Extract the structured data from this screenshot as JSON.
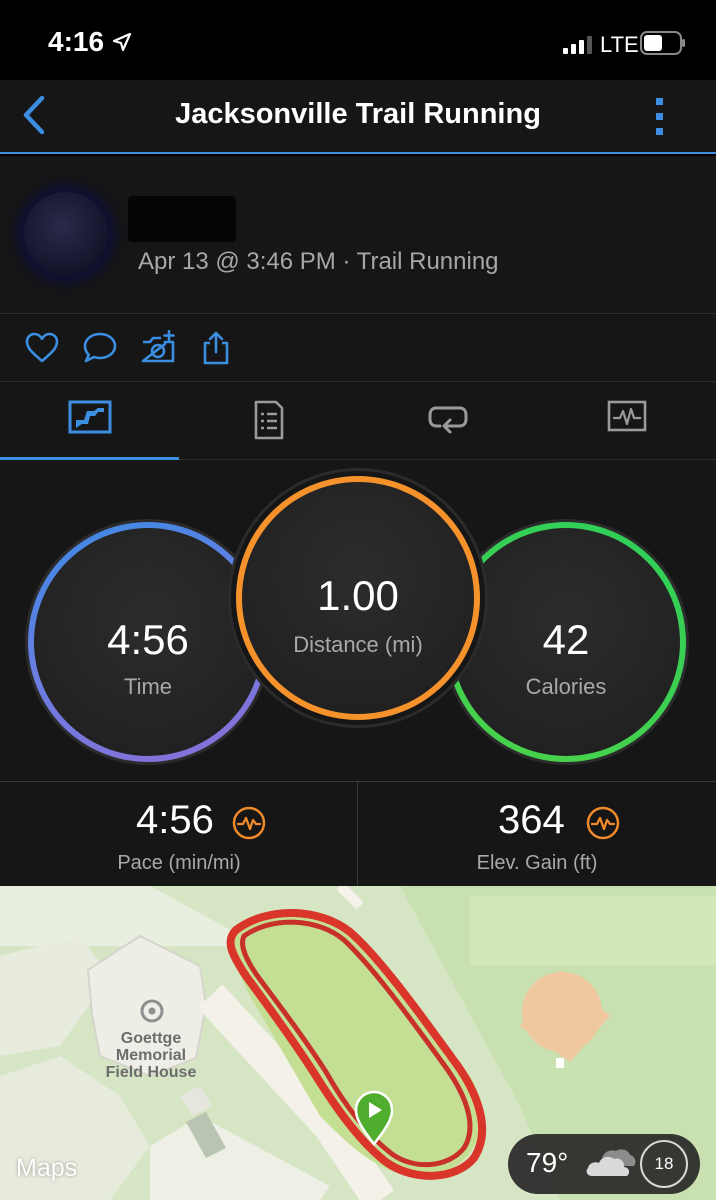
{
  "status_bar": {
    "time": "4:16",
    "carrier": "LTE"
  },
  "nav": {
    "title": "Jacksonville Trail Running"
  },
  "activity": {
    "meta": "Apr 13 @ 3:46 PM · Trail Running"
  },
  "actions": [
    {
      "icon": "heart-icon"
    },
    {
      "icon": "comment-icon"
    },
    {
      "icon": "add-photo-icon"
    },
    {
      "icon": "share-icon"
    }
  ],
  "tabs": [
    {
      "icon": "overview-icon",
      "active": true
    },
    {
      "icon": "stats-icon",
      "active": false
    },
    {
      "icon": "laps-icon",
      "active": false
    },
    {
      "icon": "charts-icon",
      "active": false
    }
  ],
  "summary": {
    "time": {
      "value": "4:56",
      "label": "Time"
    },
    "distance": {
      "value": "1.00",
      "label": "Distance (mi)"
    },
    "calories": {
      "value": "42",
      "label": "Calories"
    }
  },
  "stats": {
    "pace": {
      "value": "4:56",
      "label": "Pace (min/mi)"
    },
    "elevation": {
      "value": "364",
      "label": "Elev. Gain (ft)"
    }
  },
  "map": {
    "poi_lines": [
      "Goettge",
      "Memorial",
      "Field House"
    ],
    "brand": "Maps",
    "weather": {
      "temp": "79°",
      "aqi": "18"
    }
  },
  "colors": {
    "accent": "#3b8ee0",
    "time_ring": [
      "#3c8ae6",
      "#8a6fd8"
    ],
    "distance_ring": "#f5922c",
    "calories_ring": [
      "#2fcf5a",
      "#4ad34a"
    ],
    "route": "#d9352b",
    "stat_icon": "#f0892a"
  }
}
